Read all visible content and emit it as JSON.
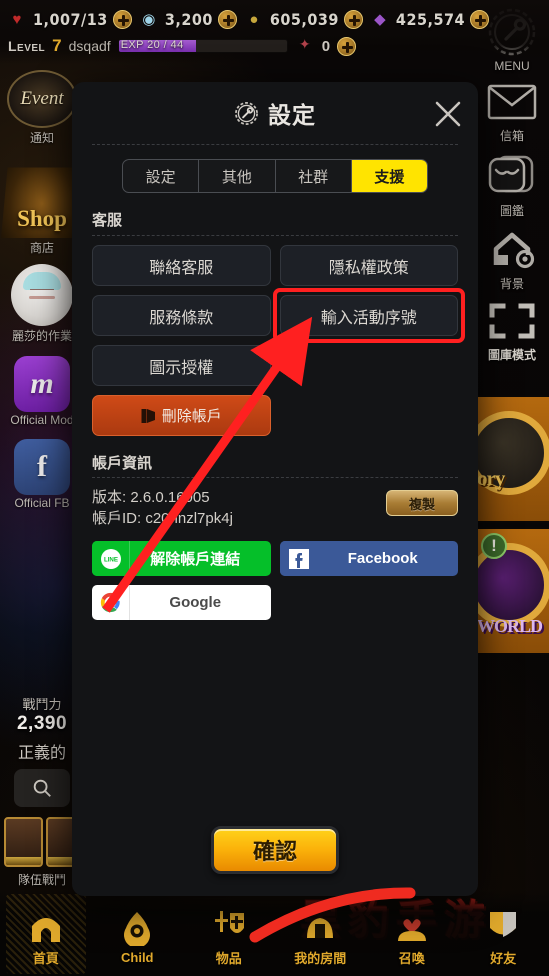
{
  "topbar": {
    "currencies": [
      {
        "icon": "heart-icon",
        "glyph": "♥",
        "value": "1,007/13"
      },
      {
        "icon": "gem-icon",
        "glyph": "◉",
        "value": "3,200"
      },
      {
        "icon": "coin-stack-icon",
        "glyph": "●",
        "value": "605,039"
      },
      {
        "icon": "crystal-icon",
        "glyph": "♦",
        "value": "425,574"
      }
    ],
    "level_word": "Level",
    "level_value": "7",
    "player_name": "dsqadf",
    "exp_text": "EXP 20 / 44",
    "exp_percent": 46,
    "extra_value": "0"
  },
  "left_rail": {
    "items": [
      {
        "icon": "event-banner-icon",
        "icon_text": "Event",
        "label": "通知"
      },
      {
        "icon": "shop-chest-icon",
        "icon_text": "Shop",
        "label": "商店"
      },
      {
        "icon": "character-portrait-icon",
        "icon_text": "",
        "label": "麗莎的作業"
      },
      {
        "icon": "official-mod-icon",
        "icon_text": "m",
        "label": "Official Mod"
      },
      {
        "icon": "official-facebook-icon",
        "icon_text": "f",
        "label": "Official FB"
      }
    ],
    "power_label": "戰鬥力",
    "power_value": "2,390",
    "justice_label": "正義的",
    "team_label": "隊伍戰鬥"
  },
  "right_rail": {
    "items": [
      {
        "icon": "gear-wrench-icon",
        "label": "MENU"
      },
      {
        "icon": "mail-icon",
        "label": "信箱"
      },
      {
        "icon": "book-collection-icon",
        "label": "圖鑑"
      },
      {
        "icon": "background-gear-icon",
        "label": "背景"
      },
      {
        "icon": "fullscreen-icon",
        "label": "圖庫模式"
      }
    ],
    "banners": [
      {
        "name": "banner-story",
        "word": "ory",
        "badge": ""
      },
      {
        "name": "banner-world",
        "word": "WORLD",
        "badge": "!"
      }
    ]
  },
  "bottom_nav": {
    "items": [
      {
        "icon": "home-gate-icon",
        "label": "首頁",
        "active": true
      },
      {
        "icon": "flame-eye-icon",
        "label": "Child",
        "active": false
      },
      {
        "icon": "sword-shield-icon",
        "label": "物品",
        "active": false
      },
      {
        "icon": "room-icon",
        "label": "我的房間",
        "active": false
      },
      {
        "icon": "summon-hand-heart-icon",
        "label": "召喚",
        "active": false
      },
      {
        "icon": "friends-shield-icon",
        "label": "好友",
        "active": false
      }
    ]
  },
  "modal": {
    "title": "設定",
    "title_icon": "gear-wrench-icon",
    "close_icon": "close-icon",
    "tabs": [
      {
        "label": "設定",
        "active": false
      },
      {
        "label": "其他",
        "active": false
      },
      {
        "label": "社群",
        "active": false
      },
      {
        "label": "支援",
        "active": true
      }
    ],
    "support_section": {
      "title": "客服",
      "buttons": [
        {
          "label": "聯絡客服",
          "highlighted": false
        },
        {
          "label": "隱私權政策",
          "highlighted": false
        },
        {
          "label": "服務條款",
          "highlighted": false
        },
        {
          "label": "輸入活動序號",
          "highlighted": true
        },
        {
          "label": "圖示授權",
          "highlighted": false
        }
      ],
      "delete_label": "刪除帳戶",
      "delete_icon": "trash-icon"
    },
    "account_section": {
      "title": "帳戶資訊",
      "version_line": "版本: 2.6.0.16005",
      "account_id_line": "帳戶ID: c20nnzl7pk4j",
      "copy_label": "複製"
    },
    "social_buttons": [
      {
        "provider": "line",
        "icon": "line-icon",
        "label": "解除帳戶連結"
      },
      {
        "provider": "facebook",
        "icon": "facebook-icon",
        "label": "Facebook"
      },
      {
        "provider": "google",
        "icon": "google-icon",
        "label": "Google"
      }
    ],
    "confirm_label": "確認"
  },
  "annotations": {
    "watermark_middle": "黑豹手游",
    "watermark_bottom": "黑豹手游",
    "arrow_color": "#ff2020",
    "highlight_color": "#ff2020"
  }
}
